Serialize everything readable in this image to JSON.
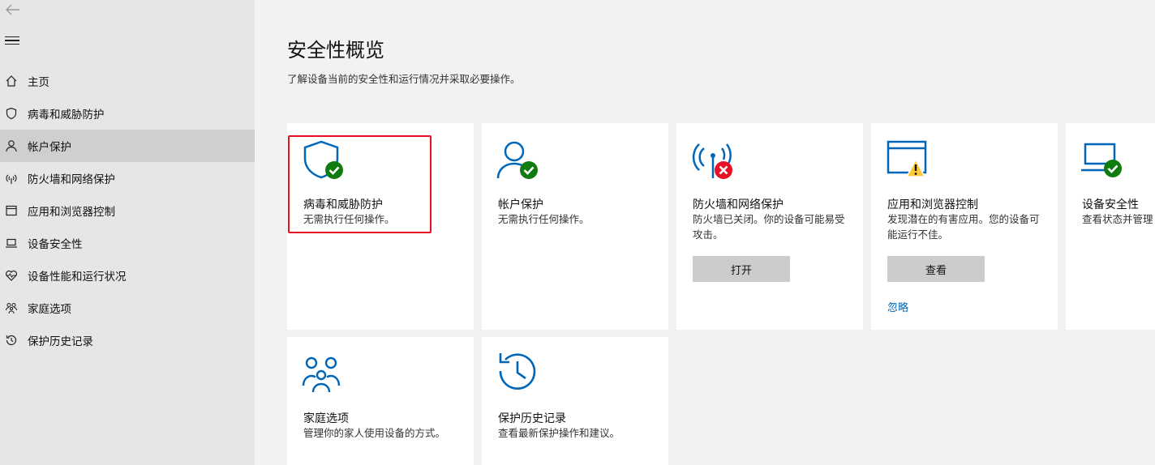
{
  "nav": {
    "back_icon": "back-arrow-icon",
    "menu_icon": "hamburger-icon",
    "items": [
      {
        "label": "主页",
        "icon": "home-icon"
      },
      {
        "label": "病毒和威胁防护",
        "icon": "shield-icon"
      },
      {
        "label": "帐户保护",
        "icon": "person-icon",
        "active": true
      },
      {
        "label": "防火墙和网络保护",
        "icon": "antenna-icon"
      },
      {
        "label": "应用和浏览器控制",
        "icon": "app-window-icon"
      },
      {
        "label": "设备安全性",
        "icon": "laptop-icon"
      },
      {
        "label": "设备性能和运行状况",
        "icon": "heart-icon"
      },
      {
        "label": "家庭选项",
        "icon": "family-icon"
      },
      {
        "label": "保护历史记录",
        "icon": "history-icon"
      }
    ]
  },
  "main": {
    "title": "安全性概览",
    "subtitle": "了解设备当前的安全性和运行情况并采取必要操作。",
    "cards": [
      {
        "title": "病毒和威胁防护",
        "desc": "无需执行任何操作。",
        "status": "ok"
      },
      {
        "title": "帐户保护",
        "desc": "无需执行任何操作。",
        "status": "ok"
      },
      {
        "title": "防火墙和网络保护",
        "desc": "防火墙已关闭。你的设备可能易受攻击。",
        "status": "error",
        "button": "打开"
      },
      {
        "title": "应用和浏览器控制",
        "desc": "发现潜在的有害应用。您的设备可能运行不佳。",
        "status": "warning",
        "button": "查看",
        "link": "忽略"
      },
      {
        "title": "设备安全性",
        "desc": "查看状态并管理",
        "status": "ok"
      },
      {
        "title": "家庭选项",
        "desc": "管理你的家人使用设备的方式。"
      },
      {
        "title": "保护历史记录",
        "desc": "查看最新保护操作和建议。"
      }
    ]
  },
  "colors": {
    "accent": "#0067b8",
    "ok": "#107c10",
    "error": "#e81123",
    "warning": "#ffc83d",
    "highlight": "#e81123"
  }
}
